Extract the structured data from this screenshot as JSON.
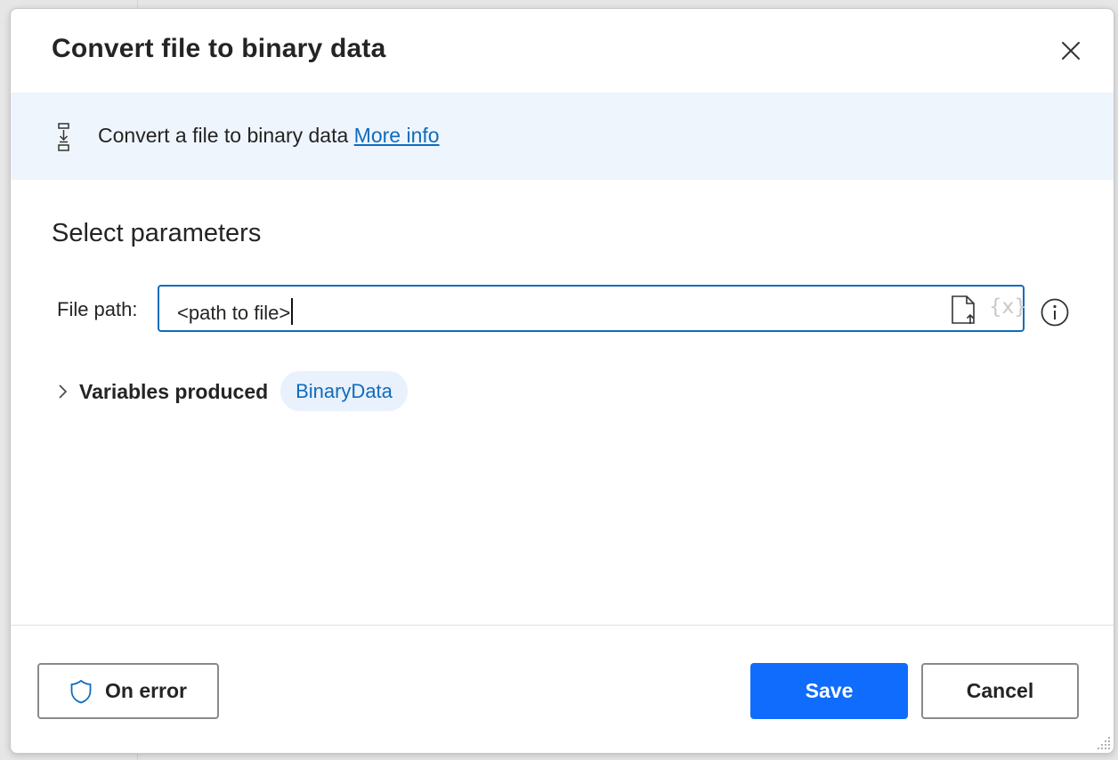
{
  "dialog": {
    "title": "Convert file to binary data",
    "close_icon": "close-icon"
  },
  "banner": {
    "icon": "convert-file-icon",
    "description": "Convert a file to binary data",
    "link_text": "More info"
  },
  "parameters": {
    "section_title": "Select parameters",
    "file_path": {
      "label": "File path:",
      "value": "<path to file>",
      "file_icon": "file-upload-icon",
      "variable_icon_text": "{x}"
    },
    "info_icon": "info-icon"
  },
  "variables_produced": {
    "label": "Variables produced",
    "chip": "BinaryData"
  },
  "footer": {
    "on_error_label": "On error",
    "save_label": "Save",
    "cancel_label": "Cancel"
  },
  "colors": {
    "accent": "#0f6cbd",
    "primary_button": "#0f6cfd",
    "banner_bg": "#eff5fd",
    "chip_bg": "#e9f1fc"
  }
}
